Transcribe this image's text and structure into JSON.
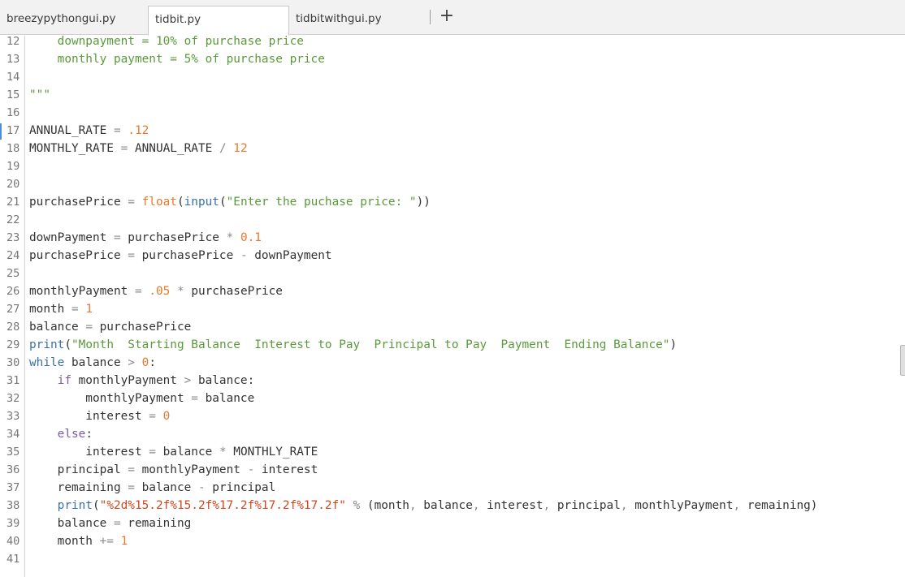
{
  "tabs": [
    {
      "label": "breezypythongui.py",
      "active": false
    },
    {
      "label": "tidbit.py",
      "active": true
    },
    {
      "label": "tidbitwithgui.py",
      "active": false
    }
  ],
  "new_tab_label": "+",
  "colors": {
    "string": "#5a9a3a",
    "number": "#e8782a",
    "keyword": "#3a6fa8",
    "format": "#d2461e",
    "line_number": "#777777",
    "cursor_marker": "#4a90d9"
  },
  "current_line": 17,
  "lines": [
    {
      "n": "12",
      "tokens": [
        [
          "t-str",
          "    downpayment = 10% of purchase price"
        ]
      ]
    },
    {
      "n": "13",
      "tokens": [
        [
          "t-str",
          "    monthly payment = 5% of purchase price"
        ]
      ]
    },
    {
      "n": "14",
      "tokens": []
    },
    {
      "n": "15",
      "tokens": [
        [
          "t-str",
          "\"\"\""
        ]
      ]
    },
    {
      "n": "16",
      "tokens": []
    },
    {
      "n": "17",
      "tokens": [
        [
          "t-plain",
          "ANNUAL_RATE "
        ],
        [
          "t-op",
          "="
        ],
        [
          "t-plain",
          " "
        ],
        [
          "t-num",
          ".12"
        ]
      ]
    },
    {
      "n": "18",
      "tokens": [
        [
          "t-plain",
          "MONTHLY_RATE "
        ],
        [
          "t-op",
          "="
        ],
        [
          "t-plain",
          " ANNUAL_RATE "
        ],
        [
          "t-op",
          "/"
        ],
        [
          "t-plain",
          " "
        ],
        [
          "t-num",
          "12"
        ]
      ]
    },
    {
      "n": "19",
      "tokens": []
    },
    {
      "n": "20",
      "tokens": []
    },
    {
      "n": "21",
      "tokens": [
        [
          "t-plain",
          "purchasePrice "
        ],
        [
          "t-op",
          "="
        ],
        [
          "t-plain",
          " "
        ],
        [
          "t-fn",
          "float"
        ],
        [
          "t-plain",
          "("
        ],
        [
          "t-bi",
          "input"
        ],
        [
          "t-plain",
          "("
        ],
        [
          "t-str",
          "\"Enter the puchase price: \""
        ],
        [
          "t-plain",
          "))"
        ]
      ]
    },
    {
      "n": "22",
      "tokens": []
    },
    {
      "n": "23",
      "tokens": [
        [
          "t-plain",
          "downPayment "
        ],
        [
          "t-op",
          "="
        ],
        [
          "t-plain",
          " purchasePrice "
        ],
        [
          "t-op",
          "*"
        ],
        [
          "t-plain",
          " "
        ],
        [
          "t-num",
          "0.1"
        ]
      ]
    },
    {
      "n": "24",
      "tokens": [
        [
          "t-plain",
          "purchasePrice "
        ],
        [
          "t-op",
          "="
        ],
        [
          "t-plain",
          " purchasePrice "
        ],
        [
          "t-op",
          "-"
        ],
        [
          "t-plain",
          " downPayment"
        ]
      ]
    },
    {
      "n": "25",
      "tokens": []
    },
    {
      "n": "26",
      "tokens": [
        [
          "t-plain",
          "monthlyPayment "
        ],
        [
          "t-op",
          "="
        ],
        [
          "t-plain",
          " "
        ],
        [
          "t-num",
          ".05"
        ],
        [
          "t-plain",
          " "
        ],
        [
          "t-op",
          "*"
        ],
        [
          "t-plain",
          " purchasePrice"
        ]
      ]
    },
    {
      "n": "27",
      "tokens": [
        [
          "t-plain",
          "month "
        ],
        [
          "t-op",
          "="
        ],
        [
          "t-plain",
          " "
        ],
        [
          "t-num",
          "1"
        ]
      ]
    },
    {
      "n": "28",
      "tokens": [
        [
          "t-plain",
          "balance "
        ],
        [
          "t-op",
          "="
        ],
        [
          "t-plain",
          " purchasePrice"
        ]
      ]
    },
    {
      "n": "29",
      "tokens": [
        [
          "t-bi",
          "print"
        ],
        [
          "t-plain",
          "("
        ],
        [
          "t-str",
          "\"Month  Starting Balance  Interest to Pay  Principal to Pay  Payment  Ending Balance\""
        ],
        [
          "t-plain",
          ")"
        ]
      ]
    },
    {
      "n": "30",
      "tokens": [
        [
          "t-kw",
          "while"
        ],
        [
          "t-plain",
          " balance "
        ],
        [
          "t-op",
          ">"
        ],
        [
          "t-plain",
          " "
        ],
        [
          "t-num",
          "0"
        ],
        [
          "t-plain",
          ":"
        ]
      ]
    },
    {
      "n": "31",
      "tokens": [
        [
          "t-plain",
          "    "
        ],
        [
          "t-purple",
          "if"
        ],
        [
          "t-plain",
          " monthlyPayment "
        ],
        [
          "t-op",
          ">"
        ],
        [
          "t-plain",
          " balance:"
        ]
      ]
    },
    {
      "n": "32",
      "tokens": [
        [
          "t-plain",
          "        monthlyPayment "
        ],
        [
          "t-op",
          "="
        ],
        [
          "t-plain",
          " balance"
        ]
      ]
    },
    {
      "n": "33",
      "tokens": [
        [
          "t-plain",
          "        interest "
        ],
        [
          "t-op",
          "="
        ],
        [
          "t-plain",
          " "
        ],
        [
          "t-num",
          "0"
        ]
      ]
    },
    {
      "n": "34",
      "tokens": [
        [
          "t-plain",
          "    "
        ],
        [
          "t-purple",
          "else"
        ],
        [
          "t-plain",
          ":"
        ]
      ]
    },
    {
      "n": "35",
      "tokens": [
        [
          "t-plain",
          "        interest "
        ],
        [
          "t-op",
          "="
        ],
        [
          "t-plain",
          " balance "
        ],
        [
          "t-op",
          "*"
        ],
        [
          "t-plain",
          " MONTHLY_RATE"
        ]
      ]
    },
    {
      "n": "36",
      "tokens": [
        [
          "t-plain",
          "    principal "
        ],
        [
          "t-op",
          "="
        ],
        [
          "t-plain",
          " monthlyPayment "
        ],
        [
          "t-op",
          "-"
        ],
        [
          "t-plain",
          " interest"
        ]
      ]
    },
    {
      "n": "37",
      "tokens": [
        [
          "t-plain",
          "    remaining "
        ],
        [
          "t-op",
          "="
        ],
        [
          "t-plain",
          " balance "
        ],
        [
          "t-op",
          "-"
        ],
        [
          "t-plain",
          " principal"
        ]
      ]
    },
    {
      "n": "38",
      "tokens": [
        [
          "t-plain",
          "    "
        ],
        [
          "t-bi",
          "print"
        ],
        [
          "t-plain",
          "("
        ],
        [
          "t-fmt",
          "\"%2d%15.2f%15.2f%17.2f%17.2f%17.2f\""
        ],
        [
          "t-plain",
          " "
        ],
        [
          "t-op",
          "%"
        ],
        [
          "t-plain",
          " (month"
        ],
        [
          "t-op",
          ","
        ],
        [
          "t-plain",
          " balance"
        ],
        [
          "t-op",
          ","
        ],
        [
          "t-plain",
          " interest"
        ],
        [
          "t-op",
          ","
        ],
        [
          "t-plain",
          " principal"
        ],
        [
          "t-op",
          ","
        ],
        [
          "t-plain",
          " monthlyPayment"
        ],
        [
          "t-op",
          ","
        ],
        [
          "t-plain",
          " remaining)"
        ]
      ]
    },
    {
      "n": "39",
      "tokens": [
        [
          "t-plain",
          "    balance "
        ],
        [
          "t-op",
          "="
        ],
        [
          "t-plain",
          " remaining"
        ]
      ]
    },
    {
      "n": "40",
      "tokens": [
        [
          "t-plain",
          "    month "
        ],
        [
          "t-op",
          "+="
        ],
        [
          "t-plain",
          " "
        ],
        [
          "t-num",
          "1"
        ]
      ]
    },
    {
      "n": "41",
      "tokens": []
    }
  ]
}
